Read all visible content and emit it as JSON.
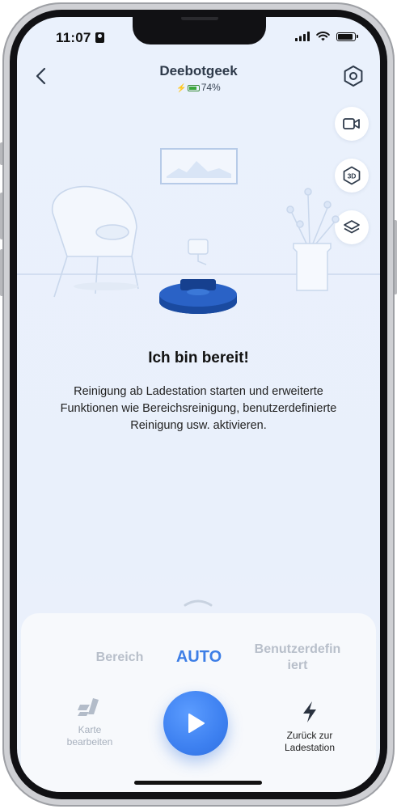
{
  "status_bar": {
    "time": "11:07"
  },
  "header": {
    "title": "Deebotgeek",
    "battery": "74%"
  },
  "message": {
    "title": "Ich bin bereit!",
    "description": "Reinigung ab Ladestation starten und erweiterte Funktionen wie Bereichsreinigung, benutzerdefinierte Reinigung usw. aktivieren."
  },
  "modes": {
    "area": "Bereich",
    "auto": "AUTO",
    "custom_line1": "Benutzerdefin",
    "custom_line2": "iert",
    "selected": "AUTO"
  },
  "actions": {
    "edit_map_line1": "Karte",
    "edit_map_line2": "bearbeiten",
    "return_line1": "Zurück zur",
    "return_line2": "Ladestation"
  },
  "colors": {
    "accent": "#3d7ee6",
    "robot": "#1e4fa8",
    "battery": "#3ba83b"
  },
  "icons": [
    "back-chevron-icon",
    "settings-hexagon-icon",
    "video-camera-icon",
    "3d-view-icon",
    "layers-icon",
    "edit-map-icon",
    "play-icon",
    "lightning-bolt-icon"
  ]
}
